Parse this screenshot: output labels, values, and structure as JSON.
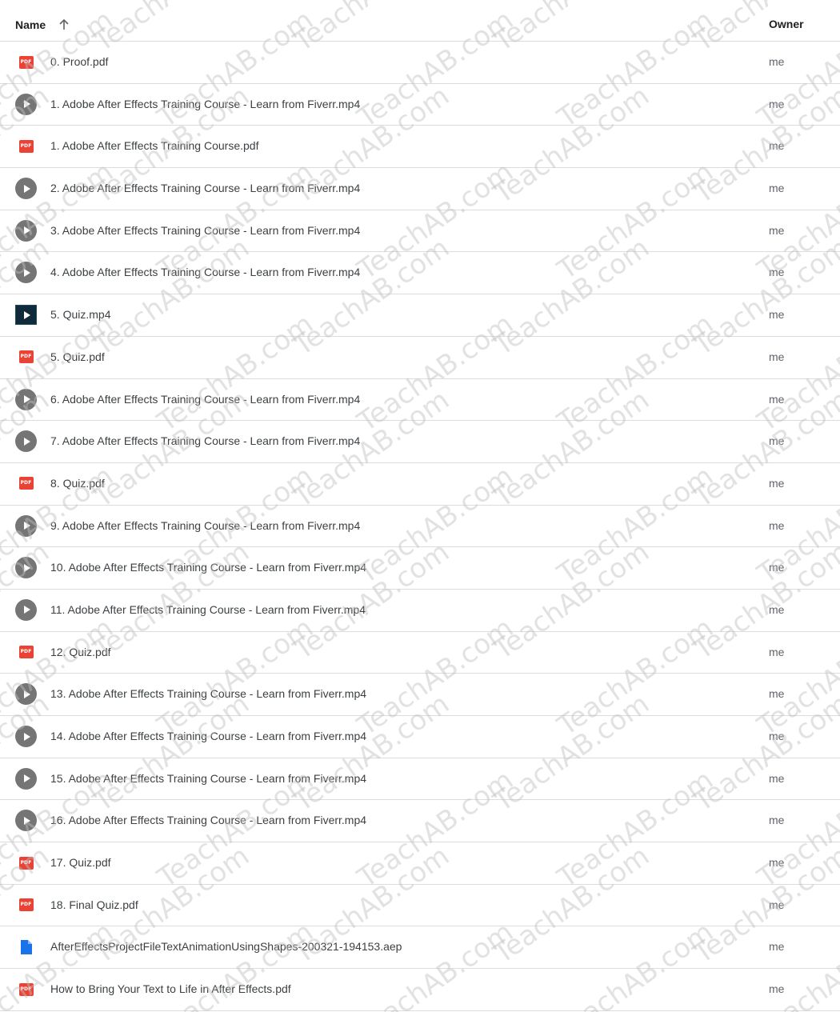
{
  "header": {
    "name_label": "Name",
    "owner_label": "Owner",
    "sort_icon": "arrow-up-icon"
  },
  "files": [
    {
      "name": "0. Proof.pdf",
      "type": "pdf",
      "owner": "me"
    },
    {
      "name": "1. Adobe After Effects Training Course - Learn from Fiverr.mp4",
      "type": "video",
      "owner": "me"
    },
    {
      "name": "1. Adobe After Effects Training Course.pdf",
      "type": "pdf",
      "owner": "me"
    },
    {
      "name": "2. Adobe After Effects Training Course - Learn from Fiverr.mp4",
      "type": "video",
      "owner": "me"
    },
    {
      "name": "3. Adobe After Effects Training Course - Learn from Fiverr.mp4",
      "type": "video",
      "owner": "me"
    },
    {
      "name": "4. Adobe After Effects Training Course - Learn from Fiverr.mp4",
      "type": "video",
      "owner": "me"
    },
    {
      "name": "5. Quiz.mp4",
      "type": "video-thumb",
      "owner": "me"
    },
    {
      "name": "5. Quiz.pdf",
      "type": "pdf",
      "owner": "me"
    },
    {
      "name": "6. Adobe After Effects Training Course - Learn from Fiverr.mp4",
      "type": "video",
      "owner": "me"
    },
    {
      "name": "7. Adobe After Effects Training Course - Learn from Fiverr.mp4",
      "type": "video",
      "owner": "me"
    },
    {
      "name": "8. Quiz.pdf",
      "type": "pdf",
      "owner": "me"
    },
    {
      "name": "9. Adobe After Effects Training Course - Learn from Fiverr.mp4",
      "type": "video",
      "owner": "me"
    },
    {
      "name": "10. Adobe After Effects Training Course - Learn from Fiverr.mp4",
      "type": "video",
      "owner": "me"
    },
    {
      "name": "11. Adobe After Effects Training Course - Learn from Fiverr.mp4",
      "type": "video",
      "owner": "me"
    },
    {
      "name": "12. Quiz.pdf",
      "type": "pdf",
      "owner": "me"
    },
    {
      "name": "13. Adobe After Effects Training Course - Learn from Fiverr.mp4",
      "type": "video",
      "owner": "me"
    },
    {
      "name": "14. Adobe After Effects Training Course - Learn from Fiverr.mp4",
      "type": "video",
      "owner": "me"
    },
    {
      "name": "15. Adobe After Effects Training Course - Learn from Fiverr.mp4",
      "type": "video",
      "owner": "me"
    },
    {
      "name": "16. Adobe After Effects Training Course - Learn from Fiverr.mp4",
      "type": "video",
      "owner": "me"
    },
    {
      "name": "17. Quiz.pdf",
      "type": "pdf",
      "owner": "me"
    },
    {
      "name": "18. Final Quiz.pdf",
      "type": "pdf",
      "owner": "me"
    },
    {
      "name": "AfterEffectsProjectFileTextAnimationUsingShapes-200321-194153.aep",
      "type": "doc",
      "owner": "me"
    },
    {
      "name": "How to Bring Your Text to Life in After Effects.pdf",
      "type": "pdf",
      "owner": "me"
    }
  ],
  "icons": {
    "pdf": "pdf-file-icon",
    "video": "play-circle-icon",
    "video-thumb": "video-thumbnail-icon",
    "doc": "generic-file-icon"
  },
  "colors": {
    "pdf_red": "#ea4335",
    "video_gray": "#757575",
    "doc_blue": "#1a73e8",
    "divider": "#dadce0"
  },
  "watermark": {
    "text": "TeachAB.com"
  }
}
